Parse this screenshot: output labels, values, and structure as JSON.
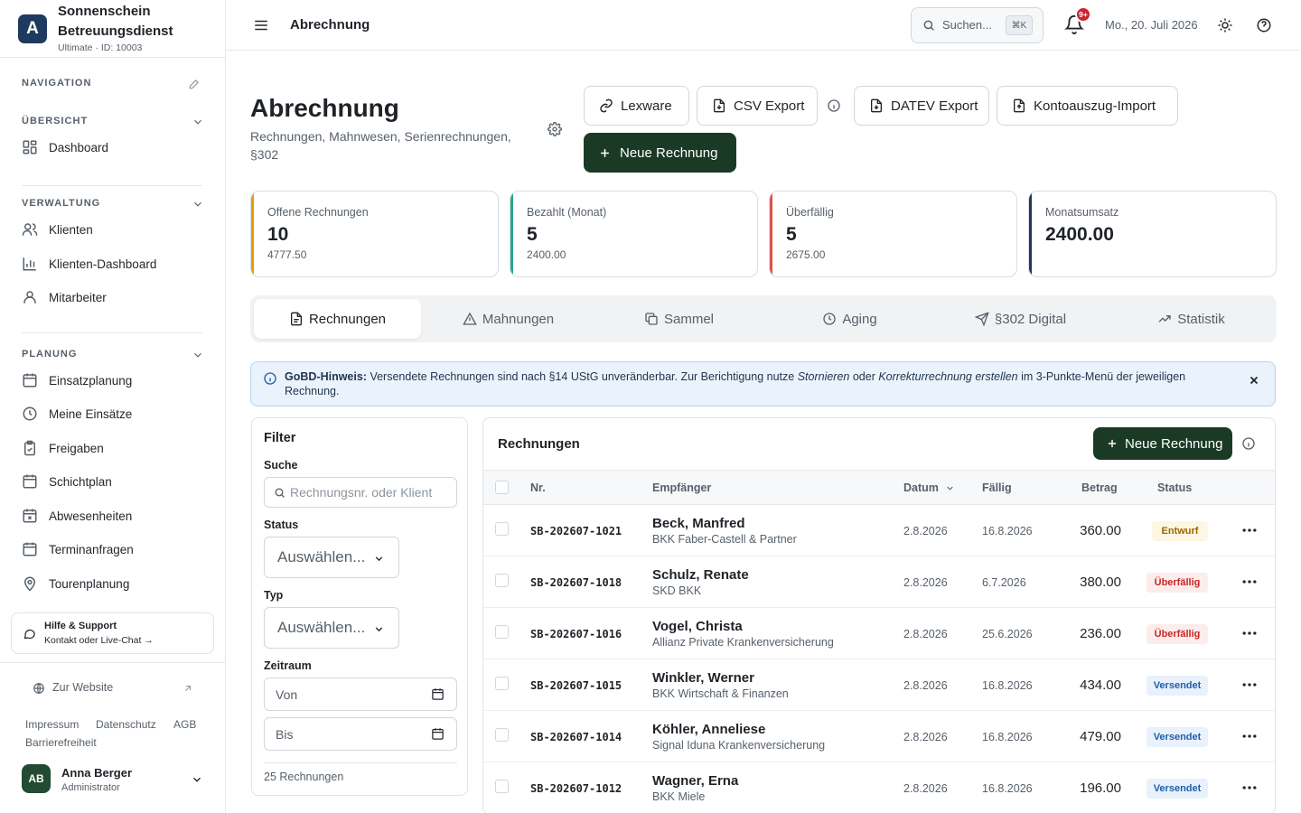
{
  "brand": {
    "logo_letter": "A",
    "name": "Sonnenschein Betreuungsdienst",
    "sub": "Ultimate · ID: 10003"
  },
  "sidebar": {
    "nav_header": "NAVIGATION",
    "groups": [
      {
        "title": "ÜBERSICHT",
        "items": [
          {
            "label": "Dashboard",
            "icon": "dashboard-icon"
          }
        ]
      },
      {
        "title": "VERWALTUNG",
        "items": [
          {
            "label": "Klienten",
            "icon": "users-icon"
          },
          {
            "label": "Klienten-Dashboard",
            "icon": "bar-chart-icon"
          },
          {
            "label": "Mitarbeiter",
            "icon": "user-icon"
          }
        ]
      },
      {
        "title": "PLANUNG",
        "items": [
          {
            "label": "Einsatzplanung",
            "icon": "calendar-icon"
          },
          {
            "label": "Meine Einsätze",
            "icon": "clock-icon"
          },
          {
            "label": "Freigaben",
            "icon": "clipboard-check-icon"
          },
          {
            "label": "Schichtplan",
            "icon": "calendar-icon"
          },
          {
            "label": "Abwesenheiten",
            "icon": "calendar-x-icon"
          },
          {
            "label": "Terminanfragen",
            "icon": "calendar-icon"
          },
          {
            "label": "Tourenplanung",
            "icon": "map-pin-icon"
          }
        ]
      }
    ],
    "help": {
      "title": "Hilfe & Support",
      "sub": "Kontakt oder Live-Chat →"
    },
    "website": "Zur Website",
    "legal": [
      "Impressum",
      "Datenschutz",
      "AGB",
      "Barrierefreiheit"
    ],
    "user": {
      "initials": "AB",
      "name": "Anna Berger",
      "role": "Administrator"
    }
  },
  "topbar": {
    "title": "Abrechnung",
    "search_placeholder": "Suchen...",
    "shortcut": "⌘K",
    "notif_badge": "9+",
    "date": "Mo., 20. Juli 2026"
  },
  "page": {
    "title": "Abrechnung",
    "subtitle": "Rechnungen, Mahnwesen, Serienrechnungen, §302",
    "buttons": {
      "lexware": "Lexware",
      "csv": "CSV Export",
      "datev": "DATEV Export",
      "kontoauszug": "Kontoauszug-Import",
      "new": "Neue Rechnung"
    }
  },
  "kpis": [
    {
      "label": "Offene Rechnungen",
      "value": "10",
      "sub": "4777.50",
      "color": "#e3a008"
    },
    {
      "label": "Bezahlt (Monat)",
      "value": "5",
      "sub": "2400.00",
      "color": "#2da58a"
    },
    {
      "label": "Überfällig",
      "value": "5",
      "sub": "2675.00",
      "color": "#d9534f"
    },
    {
      "label": "Monatsumsatz",
      "value": "2400.00",
      "sub": "",
      "color": "#1f3a5f"
    }
  ],
  "tabs": [
    "Rechnungen",
    "Mahnungen",
    "Sammel",
    "Aging",
    "§302 Digital",
    "Statistik"
  ],
  "notice": {
    "bold": "GoBD-Hinweis:",
    "t1": " Versendete Rechnungen sind nach §14 UStG unveränderbar. Zur Berichtigung nutze ",
    "i1": "Stornieren",
    "t2": " oder ",
    "i2": "Korrekturrechnung erstellen",
    "t3": " im 3-Punkte-Menü der jeweiligen",
    "t4": "Rechnung."
  },
  "filter": {
    "title": "Filter",
    "search_label": "Suche",
    "search_placeholder": "Rechnungsnr. oder Klient",
    "status_label": "Status",
    "status_value": "Auswählen...",
    "typ_label": "Typ",
    "typ_value": "Auswählen...",
    "zeitraum_label": "Zeitraum",
    "von": "Von",
    "bis": "Bis",
    "count": "25 Rechnungen"
  },
  "table": {
    "title": "Rechnungen",
    "new_button": "Neue Rechnung",
    "headers": {
      "nr": "Nr.",
      "empfaenger": "Empfänger",
      "datum": "Datum",
      "faellig": "Fällig",
      "betrag": "Betrag",
      "status": "Status"
    },
    "rows": [
      {
        "nr": "SB-202607-1021",
        "name": "Beck, Manfred",
        "payer": "BKK Faber-Castell & Partner",
        "datum": "2.8.2026",
        "faellig": "16.8.2026",
        "betrag": "360.00",
        "status": "Entwurf"
      },
      {
        "nr": "SB-202607-1018",
        "name": "Schulz, Renate",
        "payer": "SKD BKK",
        "datum": "2.8.2026",
        "faellig": "6.7.2026",
        "betrag": "380.00",
        "status": "Überfällig"
      },
      {
        "nr": "SB-202607-1016",
        "name": "Vogel, Christa",
        "payer": "Allianz Private Krankenversicherung",
        "datum": "2.8.2026",
        "faellig": "25.6.2026",
        "betrag": "236.00",
        "status": "Überfällig"
      },
      {
        "nr": "SB-202607-1015",
        "name": "Winkler, Werner",
        "payer": "BKK Wirtschaft & Finanzen",
        "datum": "2.8.2026",
        "faellig": "16.8.2026",
        "betrag": "434.00",
        "status": "Versendet"
      },
      {
        "nr": "SB-202607-1014",
        "name": "Köhler, Anneliese",
        "payer": "Signal Iduna Krankenversicherung",
        "datum": "2.8.2026",
        "faellig": "16.8.2026",
        "betrag": "479.00",
        "status": "Versendet"
      },
      {
        "nr": "SB-202607-1012",
        "name": "Wagner, Erna",
        "payer": "BKK Miele",
        "datum": "2.8.2026",
        "faellig": "16.8.2026",
        "betrag": "196.00",
        "status": "Versendet"
      }
    ]
  }
}
